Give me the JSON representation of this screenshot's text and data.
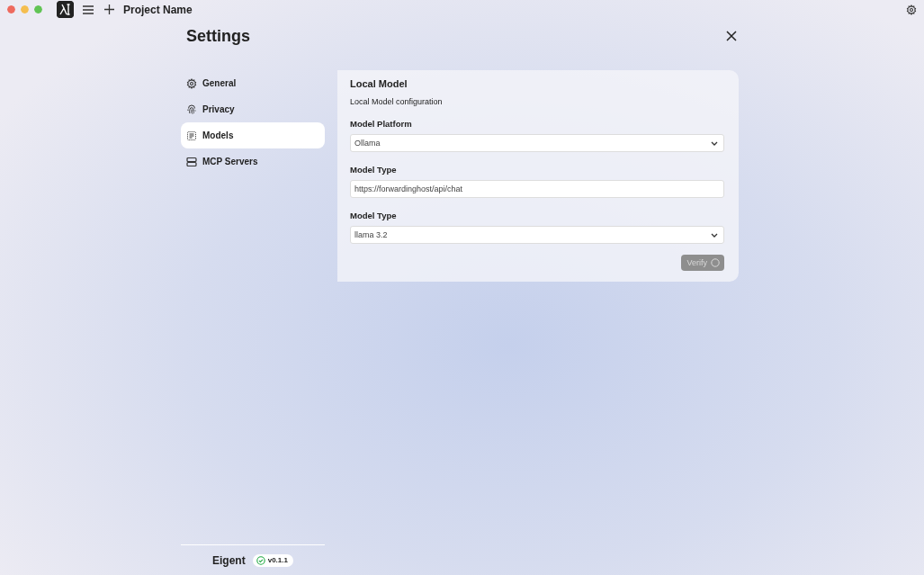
{
  "titlebar": {
    "project_name": "Project Name"
  },
  "settings": {
    "title": "Settings"
  },
  "sidebar": {
    "items": [
      {
        "label": "General",
        "selected": false
      },
      {
        "label": "Privacy",
        "selected": false
      },
      {
        "label": "Models",
        "selected": true
      },
      {
        "label": "MCP Servers",
        "selected": false
      }
    ],
    "footer": {
      "app_name": "Eigent",
      "version": "v0.1.1"
    }
  },
  "panel": {
    "title": "Local Model",
    "subtitle": "Local Model configuration",
    "fields": [
      {
        "kind": "select",
        "label": "Model Platform",
        "value": "Ollama"
      },
      {
        "kind": "text",
        "label": "Model Type",
        "value": "https://forwardinghost/api/chat"
      },
      {
        "kind": "select",
        "label": "Model Type",
        "value": "llama 3.2"
      }
    ],
    "verify_button": {
      "label": "Verify",
      "disabled": true
    }
  }
}
